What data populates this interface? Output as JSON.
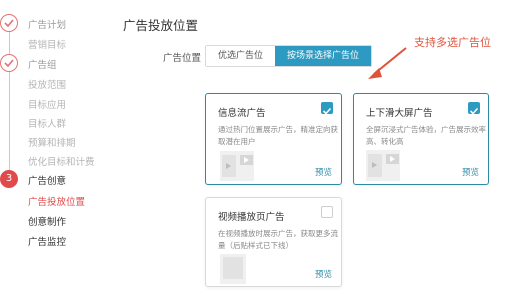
{
  "sidebar": {
    "steps": [
      {
        "label": "广告计划",
        "state": "done"
      },
      {
        "label": "营销目标",
        "state": "sub"
      },
      {
        "label": "广告组",
        "state": "done"
      },
      {
        "label": "投放范围",
        "state": "sub"
      },
      {
        "label": "目标应用",
        "state": "sub"
      },
      {
        "label": "目标人群",
        "state": "sub"
      },
      {
        "label": "预算和排期",
        "state": "sub"
      },
      {
        "label": "优化目标和计费",
        "state": "sub"
      },
      {
        "label": "广告创意",
        "state": "current",
        "number": "3"
      },
      {
        "label": "广告投放位置",
        "state": "active"
      },
      {
        "label": "创意制作",
        "state": "pending"
      },
      {
        "label": "广告监控",
        "state": "pending"
      }
    ]
  },
  "main": {
    "title": "广告投放位置",
    "placement": {
      "label": "广告位置",
      "options": [
        "优选广告位",
        "按场景选择广告位"
      ],
      "selected": "按场景选择广告位"
    },
    "annotation": "支持多选广告位",
    "cards": [
      {
        "title": "信息流广告",
        "desc_lines": [
          "通过热门位置展示广告，精准定向获",
          "取潜在用户"
        ],
        "checked": true,
        "preview": "预览"
      },
      {
        "title": "上下滑大屏广告",
        "desc_lines": [
          "全屏沉浸式广告体验，广告展示效率",
          "高、转化高"
        ],
        "checked": true,
        "preview": "预览"
      },
      {
        "title": "视频播放页广告",
        "desc_lines": [
          "在视频播放时展示广告，获取更多流",
          "量（后贴样式已下线）"
        ],
        "checked": false,
        "preview": "预览"
      }
    ]
  },
  "colors": {
    "accent": "#2d9ac1",
    "active": "#e04a4a",
    "annotation": "#e0533b"
  }
}
